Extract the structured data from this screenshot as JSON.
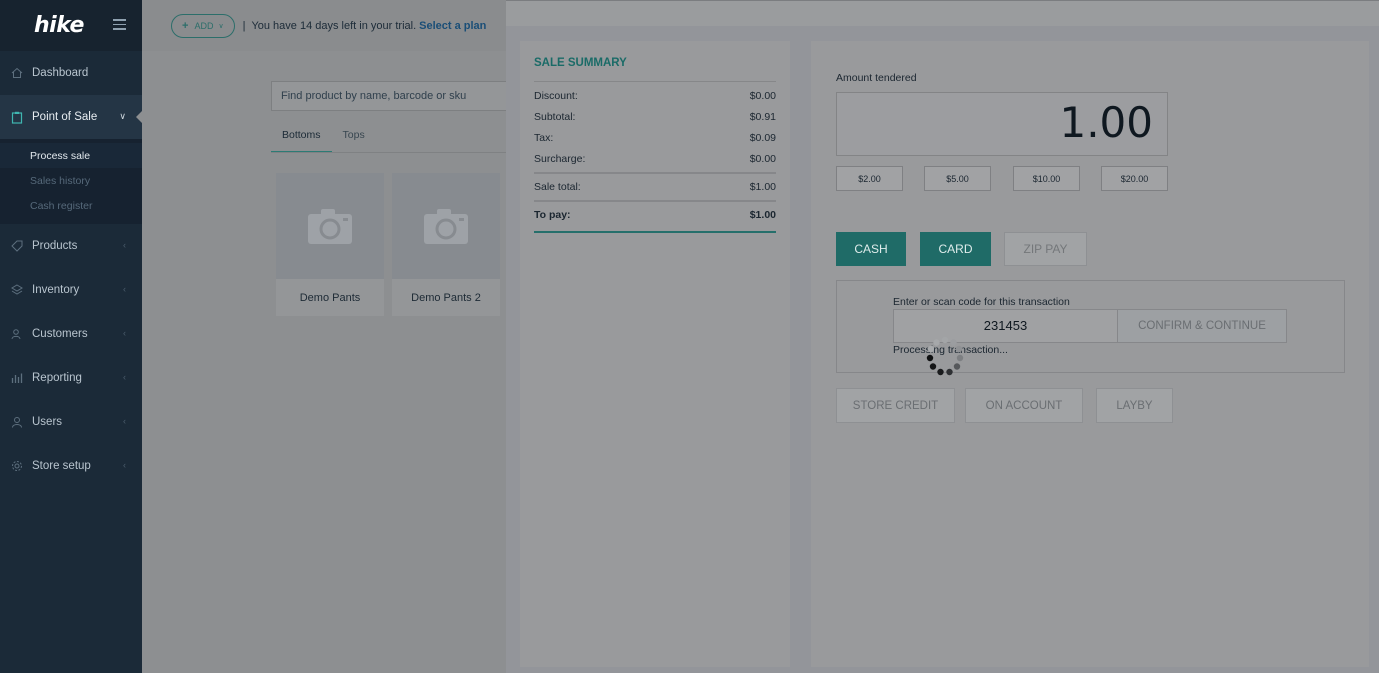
{
  "sidebar": {
    "logo": "hike",
    "nav": [
      {
        "label": "Dashboard",
        "icon": "home-icon"
      },
      {
        "label": "Point of Sale",
        "icon": "clipboard-icon",
        "active": true
      },
      {
        "label": "Products",
        "icon": "tag-icon"
      },
      {
        "label": "Inventory",
        "icon": "layers-icon"
      },
      {
        "label": "Customers",
        "icon": "users-icon"
      },
      {
        "label": "Reporting",
        "icon": "bar-chart-icon"
      },
      {
        "label": "Users",
        "icon": "user-icon"
      },
      {
        "label": "Store setup",
        "icon": "gear-icon"
      }
    ],
    "sub_items": [
      "Process sale",
      "Sales history",
      "Cash register"
    ]
  },
  "topbar": {
    "add_label": "ADD",
    "separator": "|",
    "trial_text": "You have 14 days left in your trial.",
    "trial_link": "Select a plan"
  },
  "products": {
    "search_placeholder": "Find product by name, barcode or sku",
    "tabs": [
      "Bottoms",
      "Tops"
    ],
    "items": [
      {
        "name": "Demo Pants"
      },
      {
        "name": "Demo Pants 2"
      }
    ]
  },
  "summary": {
    "title": "SALE SUMMARY",
    "rows": [
      {
        "label": "Discount:",
        "value": "$0.00"
      },
      {
        "label": "Subtotal:",
        "value": "$0.91"
      },
      {
        "label": "Tax:",
        "value": "$0.09"
      },
      {
        "label": "Surcharge:",
        "value": "$0.00"
      }
    ],
    "sale_total_label": "Sale total:",
    "sale_total_value": "$1.00",
    "to_pay_label": "To pay:",
    "to_pay_value": "$1.00"
  },
  "payment": {
    "amount_label": "Amount tendered",
    "amount_value": "1.00",
    "quick_amounts": [
      "$2.00",
      "$5.00",
      "$10.00",
      "$20.00"
    ],
    "methods": [
      "CASH",
      "CARD",
      "ZIP PAY"
    ],
    "code_label": "Enter or scan code for this transaction",
    "code_value": "231453",
    "confirm_label": "CONFIRM & CONTINUE",
    "processing_text": "Processing transaction...",
    "other_methods": [
      "STORE CREDIT",
      "ON ACCOUNT",
      "LAYBY"
    ]
  },
  "colors": {
    "sidebar_bg": "#1b2a38",
    "accent_teal": "#1f6b67",
    "overlay_grey": "#8d8f91"
  }
}
